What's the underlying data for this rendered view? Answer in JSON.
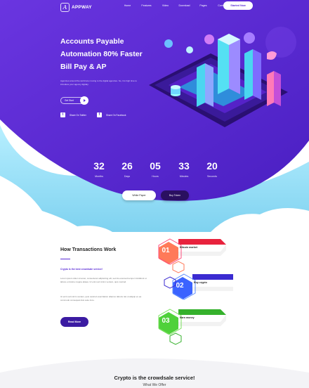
{
  "brand": {
    "logo_letter": "A",
    "name": "APPWAY"
  },
  "nav": {
    "items": [
      "Home",
      "Features",
      "Video",
      "Download",
      "Pages",
      "Contact"
    ],
    "cta": "Started Now"
  },
  "hero": {
    "headline_lines": [
      "Accounts Payable",
      "Automation 80% Faster",
      "Bill Pay & AP"
    ],
    "desc": "Agencies around the world are moving to the digital agencies. So, it is high time to introduce your agency digitaly.",
    "get_start": "Get Start",
    "social": [
      {
        "icon": "twitter-icon",
        "glyph": "t",
        "label": "Share On Twitter"
      },
      {
        "icon": "facebook-icon",
        "glyph": "f",
        "label": "Share On Facebook"
      }
    ]
  },
  "countdown": [
    {
      "value": "32",
      "label": "Months"
    },
    {
      "value": "26",
      "label": "Days"
    },
    {
      "value": "05",
      "label": "Hours"
    },
    {
      "value": "33",
      "label": "Minutes"
    },
    {
      "value": "20",
      "label": "Seconds"
    }
  ],
  "buttons": {
    "white_paper": "White Paper",
    "buy_token": "Buy Token"
  },
  "how": {
    "title": "How Transactions Work",
    "sub": "Crypto is the best crowdsale service!",
    "p1": "Lorem ipsum dolor sit amet, consectetur adipisicing elit, sed do eiusmod tempor incididunt ut labore et dolore magna aliqua. Ut enim ad minim veniam, quis nostrud.",
    "p2": "Ut enim ad minim veniam, quis nostrud exercitation ullamco laboris nisi ut aliquip ex ea commodo consequat duis aute irure.",
    "read_more": "Read More"
  },
  "steps": [
    {
      "num": "01",
      "title": "Bitcoin market",
      "color": "#e8223d"
    },
    {
      "num": "02",
      "title": "Buy crypto",
      "color": "#3b2bd1"
    },
    {
      "num": "03",
      "title": "Earn money",
      "color": "#35b12c"
    }
  ],
  "bottom": {
    "title": "Crypto is the crowdsale service!",
    "subtitle": "What We Offer"
  },
  "colors": {
    "purple": "#5a2bd6",
    "deep_purple": "#2a1060",
    "cloud": "#9fe3f5"
  }
}
